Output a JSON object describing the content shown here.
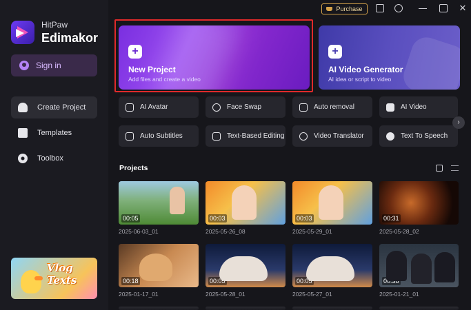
{
  "app": {
    "brand_sub": "HitPaw",
    "brand_main": "Edimakor",
    "accent": "#7a2fe0"
  },
  "titlebar": {
    "purchase_label": "Purchase",
    "icons": [
      "feedback-icon",
      "info-icon",
      "minimize-icon",
      "maximize-icon",
      "close-icon"
    ]
  },
  "sidebar": {
    "signin_label": "Sign in",
    "items": [
      {
        "label": "Create Project",
        "icon": "home-icon",
        "active": true
      },
      {
        "label": "Templates",
        "icon": "templates-icon",
        "active": false
      },
      {
        "label": "Toolbox",
        "icon": "toolbox-icon",
        "active": false
      }
    ],
    "promo_text": "Vlog Texts"
  },
  "hero": {
    "new_project": {
      "title": "New Project",
      "subtitle": "Add files and create a video"
    },
    "ai_video": {
      "title": "AI Video Generator",
      "subtitle": "AI idea or script to video"
    }
  },
  "features": [
    {
      "label": "AI Avatar",
      "icon": "avatar-icon"
    },
    {
      "label": "Face Swap",
      "icon": "face-swap-icon"
    },
    {
      "label": "Auto removal",
      "icon": "auto-removal-icon"
    },
    {
      "label": "AI Video",
      "icon": "ai-video-icon"
    },
    {
      "label": "Auto Subtitles",
      "icon": "subtitles-icon"
    },
    {
      "label": "Text-Based Editing",
      "icon": "text-edit-icon"
    },
    {
      "label": "Video Translator",
      "icon": "translator-icon"
    },
    {
      "label": "Text To Speech",
      "icon": "tts-icon"
    }
  ],
  "projects": {
    "heading": "Projects",
    "items": [
      {
        "duration": "00:05",
        "date": "2025-06-03_01"
      },
      {
        "duration": "00:03",
        "date": "2025-05-26_08"
      },
      {
        "duration": "00:03",
        "date": "2025-05-29_01"
      },
      {
        "duration": "00:31",
        "date": "2025-05-28_02"
      },
      {
        "duration": "00:18",
        "date": "2025-01-17_01"
      },
      {
        "duration": "00:05",
        "date": "2025-05-28_01"
      },
      {
        "duration": "00:05",
        "date": "2025-05-27_01"
      },
      {
        "duration": "00:38",
        "date": "2025-01-21_01"
      }
    ]
  }
}
